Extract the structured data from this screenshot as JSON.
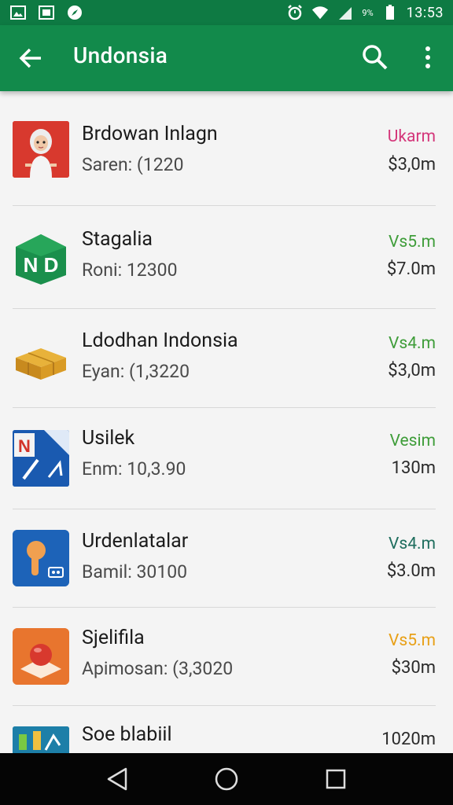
{
  "status_bar": {
    "battery_text": "9%",
    "time": "13:53"
  },
  "app_bar": {
    "title": "Undonsia"
  },
  "items": [
    {
      "name": "Brdowan Inlagn",
      "sub": "Saren: (1220",
      "tag": "Ukarm",
      "tag_color": "#d4367a",
      "price": "$3,0m"
    },
    {
      "name": "Stagalia",
      "sub": "Roni: 12300",
      "tag": "Vs5.m",
      "tag_color": "#3f9d3a",
      "price": "$7.0m"
    },
    {
      "name": "Ldodhan Indonsia",
      "sub": "Eyan: (1,3220",
      "tag": "Vs4.m",
      "tag_color": "#3f9d3a",
      "price": "$3,0m"
    },
    {
      "name": "Usilek",
      "sub": "Enm: 10,3.90",
      "tag": "Vesim",
      "tag_color": "#3f9d3a",
      "price": "130m"
    },
    {
      "name": "Urdenlatalar",
      "sub": "Bamil: 30100",
      "tag": "Vs4.m",
      "tag_color": "#1f6e5e",
      "price": "$3.0m"
    },
    {
      "name": "Sjelifila",
      "sub": "Apimosan: (3,3020",
      "tag": "Vs5.m",
      "tag_color": "#e8a017",
      "price": "$30m"
    },
    {
      "name": "Soe blabiil",
      "sub": "",
      "tag": "",
      "tag_color": "#3f9d3a",
      "price": "1020m"
    }
  ]
}
